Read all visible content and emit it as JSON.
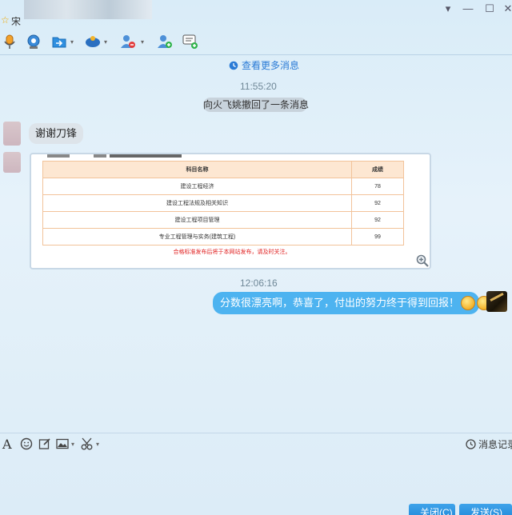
{
  "window": {
    "title_partial": "宋",
    "star_glyph": "☆",
    "controls": {
      "dropdown": "▾",
      "minimize": "—",
      "maximize": "☐",
      "close": "✕"
    }
  },
  "toolbar": {
    "icons": [
      "microphone-icon",
      "webcam-icon",
      "file-transfer-icon",
      "remote-assist-icon",
      "remove-contact-icon",
      "add-contact-icon",
      "create-discussion-icon"
    ],
    "caret": "▾"
  },
  "chat": {
    "more_messages": "查看更多消息",
    "time1": "11:55:20",
    "recall_notice": "向火飞姚撤回了一条消息",
    "msg1": "谢谢刀锋",
    "score_table": {
      "headers": [
        "科目名称",
        "成绩"
      ],
      "rows": [
        [
          "建设工程经济",
          "78"
        ],
        [
          "建设工程法规及相关知识",
          "92"
        ],
        [
          "建设工程项目管理",
          "92"
        ],
        [
          "专业工程管理与实务(建筑工程)",
          "99"
        ]
      ],
      "note": "合格标准发布后将于本网站发布，请及时关注。"
    },
    "time2": "12:06:16",
    "msg2": "分数很漂亮啊，恭喜了，付出的努力终于得到回报！"
  },
  "input_toolbar": {
    "font_glyph": "A",
    "history_label": "消息记录"
  },
  "buttons": {
    "close_label": "关闭(C)",
    "send_label": "发送(S)"
  },
  "colors": {
    "accent": "#4db3f0",
    "link": "#2a7bd6",
    "button": "#1d85d6"
  }
}
